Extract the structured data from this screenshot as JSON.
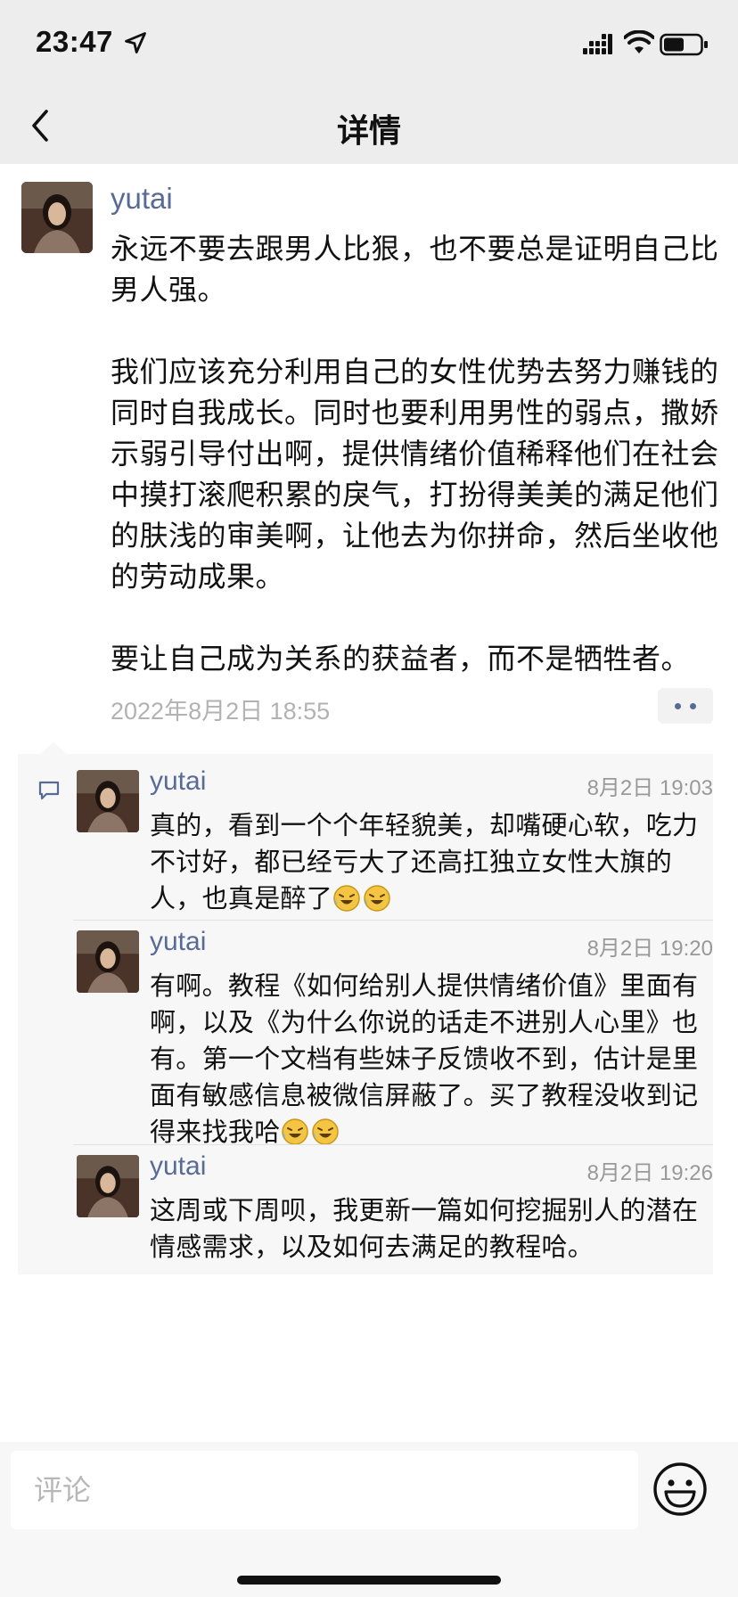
{
  "status_bar": {
    "time": "23:47"
  },
  "nav": {
    "title": "详情"
  },
  "post": {
    "author": "yutai",
    "paragraphs": [
      "永远不要去跟男人比狠，也不要总是证明自己比男人强。",
      "我们应该充分利用自己的女性优势去努力赚钱的同时自我成长。同时也要利用男性的弱点，撒娇示弱引导付出啊，提供情绪价值稀释他们在社会中摸打滚爬积累的戾气，打扮得美美的满足他们的肤浅的审美啊，让他去为你拼命，然后坐收他的劳动成果。",
      "要让自己成为关系的获益者，而不是牺牲者。"
    ],
    "timestamp": "2022年8月2日 18:55"
  },
  "comments": [
    {
      "author": "yutai",
      "time": "8月2日 19:03",
      "text": "真的，看到一个个年轻貌美，却嘴硬心软，吃力不讨好，都已经亏大了还高扛独立女性大旗的人，也真是醉了",
      "emoji_count": 2
    },
    {
      "author": "yutai",
      "time": "8月2日 19:20",
      "text": "有啊。教程《如何给别人提供情绪价值》里面有啊，以及《为什么你说的话走不进别人心里》也有。第一个文档有些妹子反馈收不到，估计是里面有敏感信息被微信屏蔽了。买了教程没收到记得来找我哈",
      "emoji_count": 2
    },
    {
      "author": "yutai",
      "time": "8月2日 19:26",
      "text": "这周或下周呗，我更新一篇如何挖掘别人的潜在情感需求，以及如何去满足的教程哈。",
      "emoji_count": 0
    }
  ],
  "comment_input": {
    "placeholder": "评论"
  },
  "colors": {
    "link_blue": "#576b95",
    "nav_bg": "#ededed",
    "comment_bg": "#f7f7f7"
  }
}
